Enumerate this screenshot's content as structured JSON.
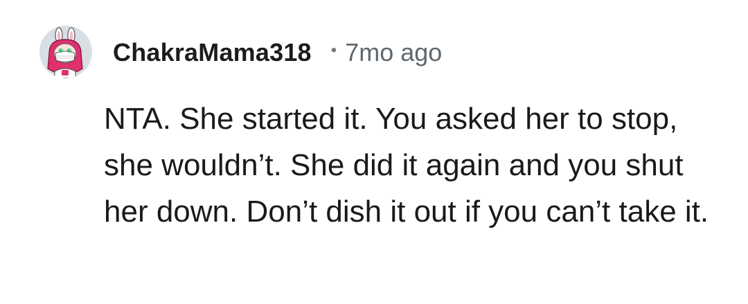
{
  "comment": {
    "author": "ChakraMama318",
    "separator": "•",
    "timestamp": "7mo ago",
    "body": "NTA. She started it. You asked her to stop, she wouldn’t. She did it again and you shut her down. Don’t dish it out if you can’t take it."
  },
  "avatar": {
    "icon": "bunny-avatar-icon",
    "background_color": "#d9dee3",
    "accent_color": "#e0306e"
  },
  "colors": {
    "username": "#1c1c1c",
    "timestamp": "#5d6870",
    "body": "#1a1a1a"
  }
}
